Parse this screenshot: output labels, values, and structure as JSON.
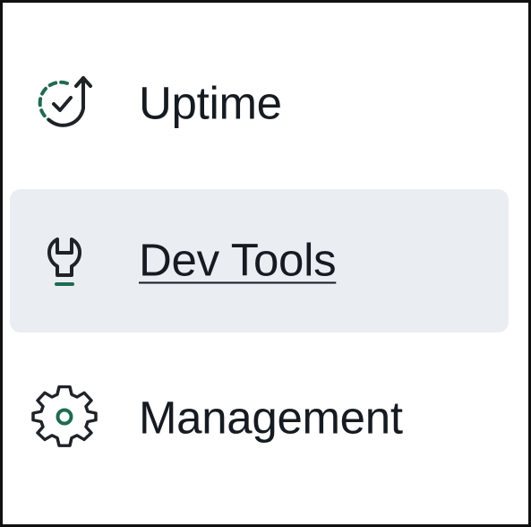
{
  "nav": {
    "items": [
      {
        "id": "uptime",
        "label": "Uptime",
        "icon": "uptime-icon",
        "active": false
      },
      {
        "id": "dev-tools",
        "label": "Dev Tools",
        "icon": "wrench-icon",
        "active": true
      },
      {
        "id": "management",
        "label": "Management",
        "icon": "gear-icon",
        "active": false
      }
    ]
  },
  "colors": {
    "text": "#161b22",
    "icon_stroke": "#1f2328",
    "accent": "#1f6b4f",
    "active_bg": "#eaedf2",
    "border": "#111111"
  }
}
